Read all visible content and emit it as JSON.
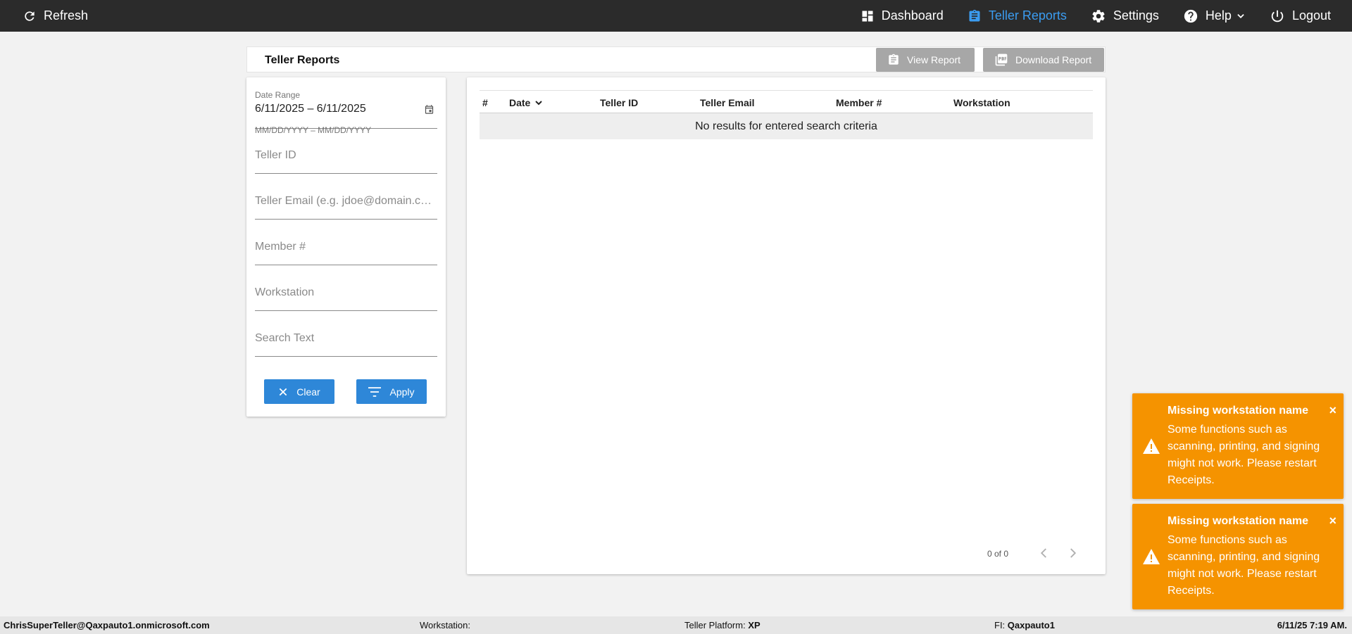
{
  "topbar": {
    "refresh_label": "Refresh",
    "nav": [
      {
        "label": "Dashboard",
        "icon": "dashboard-icon",
        "active": false
      },
      {
        "label": "Teller Reports",
        "icon": "clipboard-icon",
        "active": true
      },
      {
        "label": "Settings",
        "icon": "gear-icon",
        "active": false
      },
      {
        "label": "Help",
        "icon": "help-circle-icon",
        "active": false
      },
      {
        "label": "Logout",
        "icon": "power-icon",
        "active": false
      }
    ],
    "colors": {
      "background": "#2b2b2b",
      "active": "#3b9cf0"
    }
  },
  "page": {
    "title": "Teller Reports",
    "view_report_label": "View Report",
    "download_report_label": "Download Report"
  },
  "filters": {
    "date_range_label": "Date Range",
    "date_range_value": "6/11/2025 – 6/11/2025",
    "date_range_hint": "MM/DD/YYYY – MM/DD/YYYY",
    "teller_id_placeholder": "Teller ID",
    "teller_email_placeholder": "Teller Email (e.g. jdoe@domain.com)",
    "member_placeholder": "Member #",
    "workstation_placeholder": "Workstation",
    "search_text_placeholder": "Search Text",
    "clear_label": "Clear",
    "apply_label": "Apply",
    "button_color": "#2e87d8"
  },
  "table": {
    "columns": [
      "#",
      "Date",
      "Teller ID",
      "Teller Email",
      "Member #",
      "Workstation"
    ],
    "sorted_column": "Date",
    "empty_message": "No results for entered search criteria",
    "pagination": "0 of 0"
  },
  "toasts": [
    {
      "title": "Missing workstation name",
      "message": "Some functions such as scanning, printing, and signing might not work. Please restart Receipts."
    },
    {
      "title": "Missing workstation name",
      "message": "Some functions such as scanning, printing, and signing might not work. Please restart Receipts."
    }
  ],
  "toast_color": "#f59300",
  "statusbar": {
    "user": "ChrisSuperTeller@Qaxpauto1.onmicrosoft.com",
    "workstation_label": "Workstation:",
    "workstation_value": "",
    "platform_label": "Teller Platform:",
    "platform_value": "XP",
    "fi_label": "FI:",
    "fi_value": "Qaxpauto1",
    "datetime": "6/11/25 7:19 AM."
  }
}
